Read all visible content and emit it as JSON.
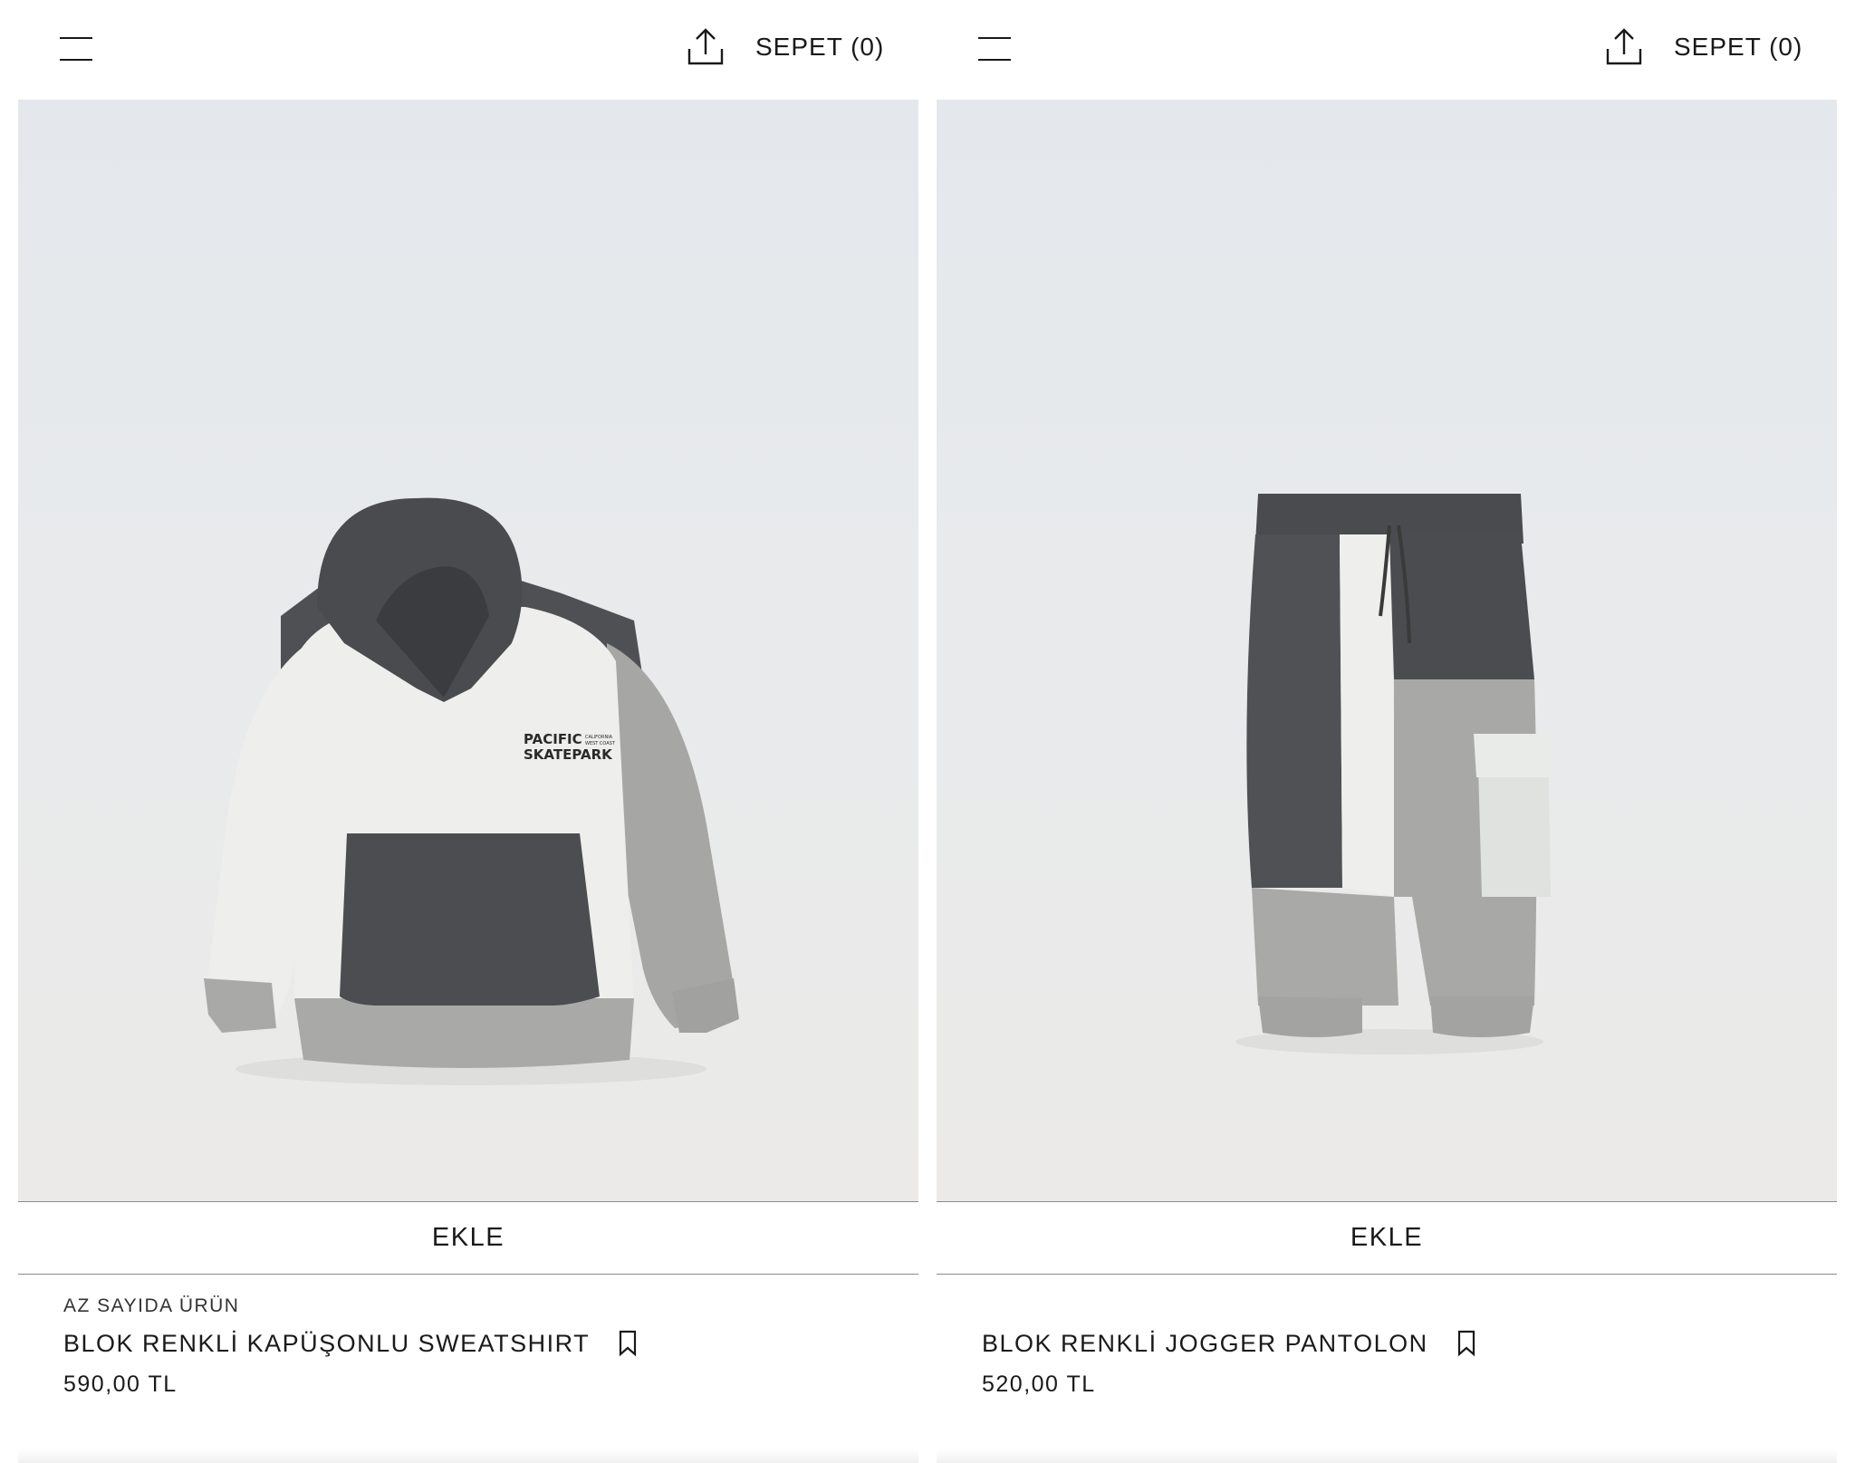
{
  "panels": [
    {
      "cart_label": "SEPET (0)",
      "add_label": "EKLE",
      "badge": "AZ SAYIDA ÜRÜN",
      "name": "BLOK RENKLİ KAPÜŞONLU SWEATSHIRT",
      "price": "590,00 TL",
      "print_line1": "PACIFIC",
      "print_line2": "SKATEPARK",
      "print_small1": "CALIFORNIA",
      "print_small2": "WEST COAST"
    },
    {
      "cart_label": "SEPET (0)",
      "add_label": "EKLE",
      "name": "BLOK RENKLİ JOGGER PANTOLON",
      "price": "520,00 TL"
    }
  ],
  "icons": {
    "menu": "menu-icon",
    "share": "share-icon",
    "bookmark": "bookmark-icon"
  },
  "colors": {
    "text": "#1a1a1a",
    "divider": "#8a8a8a",
    "garment_dark": "#4a4b4e",
    "garment_light": "#eeefec",
    "garment_grey": "#a9aaa7"
  }
}
